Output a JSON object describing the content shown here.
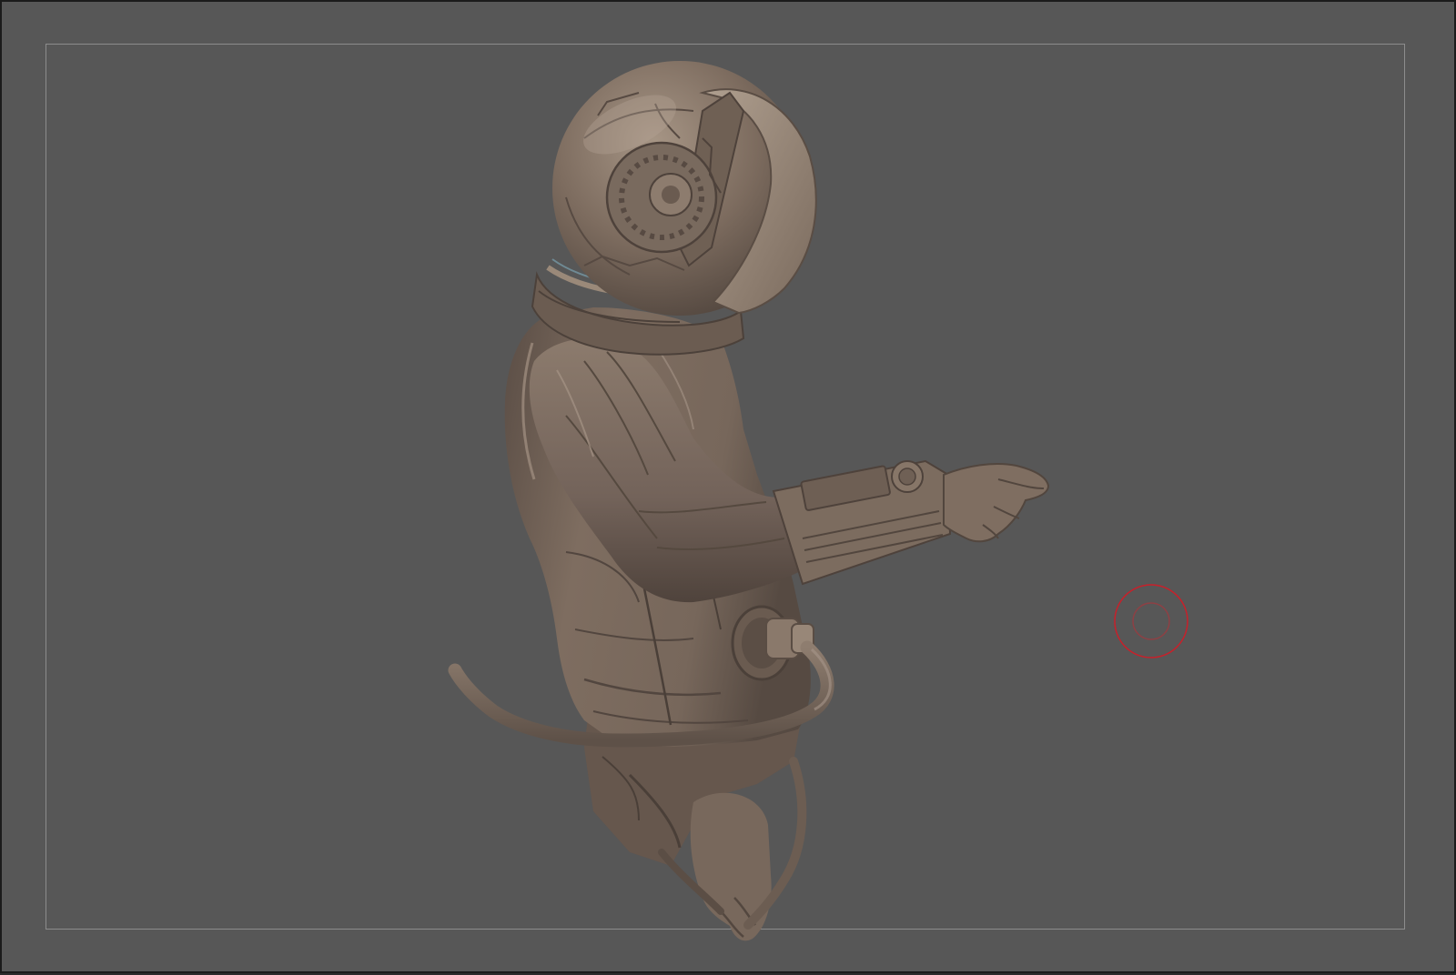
{
  "viewport": {
    "background_color": "#575757",
    "frame_color": "#8c8c8c"
  },
  "model": {
    "clay_color": "#7d6c5f",
    "shadow_color": "#4e423b",
    "highlight_color": "#9f8e80"
  },
  "brush_cursor": {
    "color": "#c8202a"
  }
}
